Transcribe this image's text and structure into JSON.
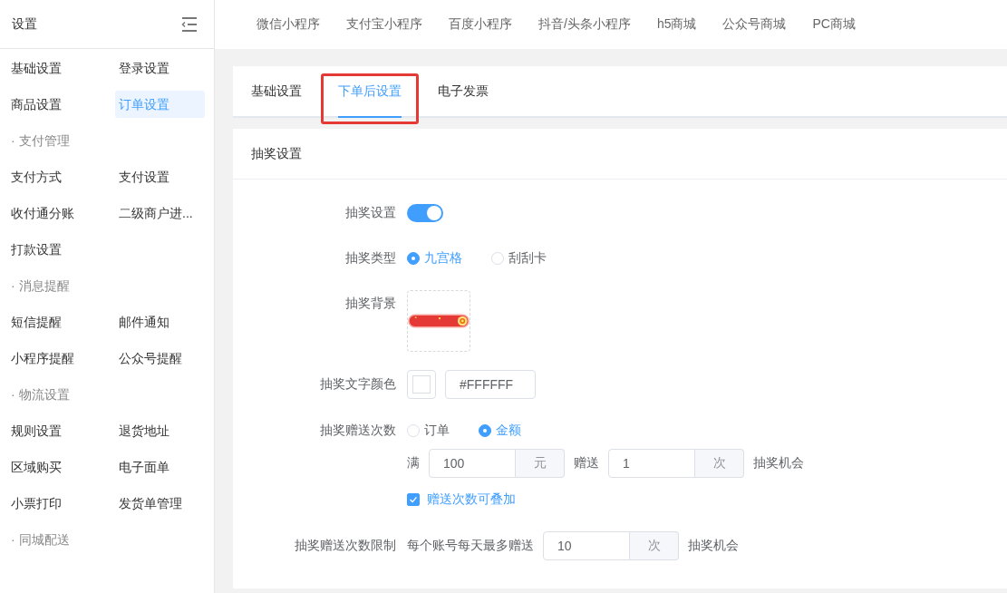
{
  "sidebar": {
    "title": "设置",
    "groups": [
      {
        "items": [
          {
            "label": "基础设置",
            "selected": false
          },
          {
            "label": "登录设置",
            "selected": false
          },
          {
            "label": "商品设置",
            "selected": false
          },
          {
            "label": "订单设置",
            "selected": true
          }
        ]
      },
      {
        "heading": "· 支付管理",
        "items": [
          {
            "label": "支付方式",
            "selected": false
          },
          {
            "label": "支付设置",
            "selected": false
          },
          {
            "label": "收付通分账",
            "selected": false
          },
          {
            "label": "二级商户进...",
            "selected": false
          },
          {
            "label": "打款设置",
            "selected": false
          }
        ]
      },
      {
        "heading": "· 消息提醒",
        "items": [
          {
            "label": "短信提醒",
            "selected": false
          },
          {
            "label": "邮件通知",
            "selected": false
          },
          {
            "label": "小程序提醒",
            "selected": false
          },
          {
            "label": "公众号提醒",
            "selected": false
          }
        ]
      },
      {
        "heading": "· 物流设置",
        "items": [
          {
            "label": "规则设置",
            "selected": false
          },
          {
            "label": "退货地址",
            "selected": false
          },
          {
            "label": "区域购买",
            "selected": false
          },
          {
            "label": "电子面单",
            "selected": false
          },
          {
            "label": "小票打印",
            "selected": false
          },
          {
            "label": "发货单管理",
            "selected": false
          }
        ]
      },
      {
        "heading": "· 同城配送"
      }
    ]
  },
  "platform_tabs": [
    {
      "label": "微信小程序",
      "selected": false
    },
    {
      "label": "支付宝小程序",
      "selected": false
    },
    {
      "label": "百度小程序",
      "selected": false
    },
    {
      "label": "抖音/头条小程序",
      "selected": false
    },
    {
      "label": "h5商城",
      "selected": false
    },
    {
      "label": "公众号商城",
      "selected": false
    },
    {
      "label": "PC商城",
      "selected": false
    }
  ],
  "tabs": [
    {
      "label": "基础设置",
      "selected": false,
      "highlighted": false
    },
    {
      "label": "下单后设置",
      "selected": true,
      "highlighted": true
    },
    {
      "label": "电子发票",
      "selected": false,
      "highlighted": false
    }
  ],
  "section_title": "抽奖设置",
  "form": [
    {
      "kind": "switch",
      "label": "抽奖设置",
      "on": true
    },
    {
      "kind": "radio",
      "label": "抽奖类型",
      "options": [
        {
          "label": "九宫格",
          "selected": true
        },
        {
          "label": "刮刮卡",
          "selected": false
        }
      ]
    },
    {
      "kind": "image",
      "label": "抽奖背景"
    },
    {
      "kind": "color",
      "label": "抽奖文字颜色",
      "value": "#FFFFFF"
    },
    {
      "kind": "radio",
      "label": "抽奖赠送次数",
      "options": [
        {
          "label": "订单",
          "selected": false
        },
        {
          "label": "金额",
          "selected": true
        }
      ]
    },
    {
      "kind": "rule",
      "prefix": "满",
      "amount": "100",
      "amount_unit": "元",
      "middle": "赠送",
      "count": "1",
      "count_unit": "次",
      "suffix": "抽奖机会"
    },
    {
      "kind": "checkbox",
      "label": "赠送次数可叠加",
      "checked": true
    },
    {
      "kind": "limit",
      "label": "抽奖赠送次数限制",
      "prefix": "每个账号每天最多赠送",
      "value": "10",
      "unit": "次",
      "suffix": "抽奖机会"
    }
  ]
}
